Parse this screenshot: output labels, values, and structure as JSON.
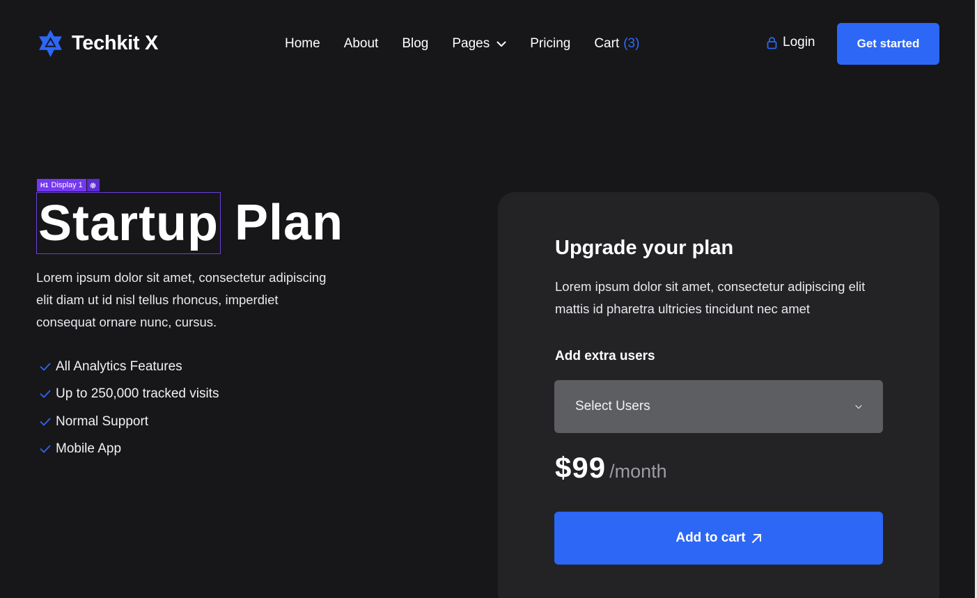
{
  "colors": {
    "background": "#171719",
    "card": "#232326",
    "accent": "#2c67f6",
    "select": "#5d5e61",
    "badge": "#7438f0"
  },
  "header": {
    "brand": "Techkit X",
    "nav": [
      {
        "label": "Home"
      },
      {
        "label": "About"
      },
      {
        "label": "Blog"
      },
      {
        "label": "Pages",
        "icon": "chevron-down-icon"
      },
      {
        "label": "Pricing"
      },
      {
        "label": "Cart",
        "count": "(3)"
      }
    ],
    "login_label": "Login",
    "cta_label": "Get started"
  },
  "hero": {
    "badge": {
      "tag": "H1",
      "label": "Display 1",
      "icon": "gear-icon"
    },
    "title_selected": "Startup",
    "title_rest": "Plan",
    "description": "Lorem ipsum dolor sit amet, consectetur adipiscing elit diam ut id nisl tellus rhoncus, imperdiet consequat ornare nunc, cursus.",
    "features": [
      "All Analytics Features",
      "Up to 250,000 tracked visits",
      "Normal Support",
      "Mobile App"
    ]
  },
  "card": {
    "title": "Upgrade your plan",
    "description": "Lorem ipsum dolor sit amet, consectetur adipiscing elit mattis id pharetra ultricies tincidunt nec amet",
    "users_label": "Add extra users",
    "select_value": "Select Users",
    "price": "$99",
    "period": "/month",
    "button_label": "Add to cart"
  }
}
